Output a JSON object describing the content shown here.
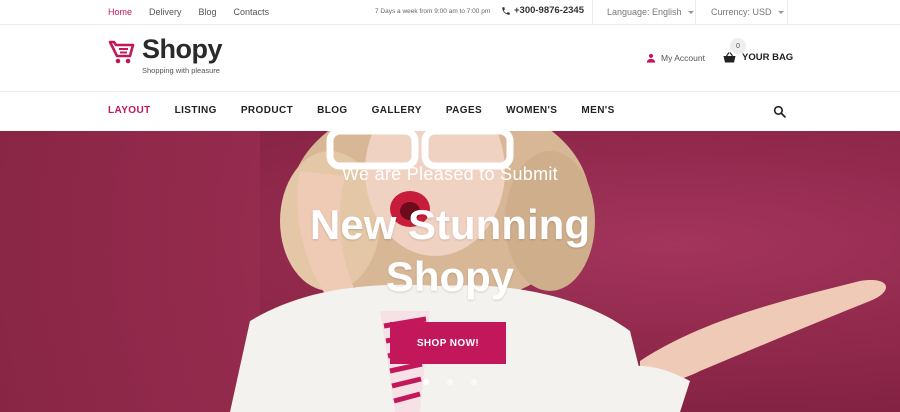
{
  "topbar": {
    "links": [
      {
        "label": "Home",
        "active": true
      },
      {
        "label": "Delivery",
        "active": false
      },
      {
        "label": "Blog",
        "active": false
      },
      {
        "label": "Contacts",
        "active": false
      }
    ],
    "hours": "7 Days a week from 9:00 am to 7:00 pm",
    "phone": "+300-9876-2345",
    "language": "Language: English",
    "currency": "Currency: USD"
  },
  "header": {
    "logo": "Shopy",
    "tagline": "Shopping with pleasure",
    "account_label": "My Account",
    "bag_label": "YOUR BAG",
    "bag_count": "0"
  },
  "nav": {
    "items": [
      {
        "label": "LAYOUT",
        "active": true
      },
      {
        "label": "LISTING",
        "active": false
      },
      {
        "label": "PRODUCT",
        "active": false
      },
      {
        "label": "BLOG",
        "active": false
      },
      {
        "label": "GALLERY",
        "active": false
      },
      {
        "label": "PAGES",
        "active": false
      },
      {
        "label": "WOMEN'S",
        "active": false
      },
      {
        "label": "MEN'S",
        "active": false
      }
    ]
  },
  "hero": {
    "subtitle": "We are Pleased to Submit",
    "title_line1": "New Stunning",
    "title_line2": "Shopy",
    "button_label": "SHOP NOW!",
    "slides": 3,
    "active_slide": 1
  },
  "colors": {
    "accent": "#c2185b",
    "hero_bg": "#8c2648"
  },
  "icons": {
    "phone": "phone-icon",
    "account": "user-icon",
    "bag": "basket-icon",
    "search": "search-icon",
    "logo": "cart-logo-icon"
  }
}
